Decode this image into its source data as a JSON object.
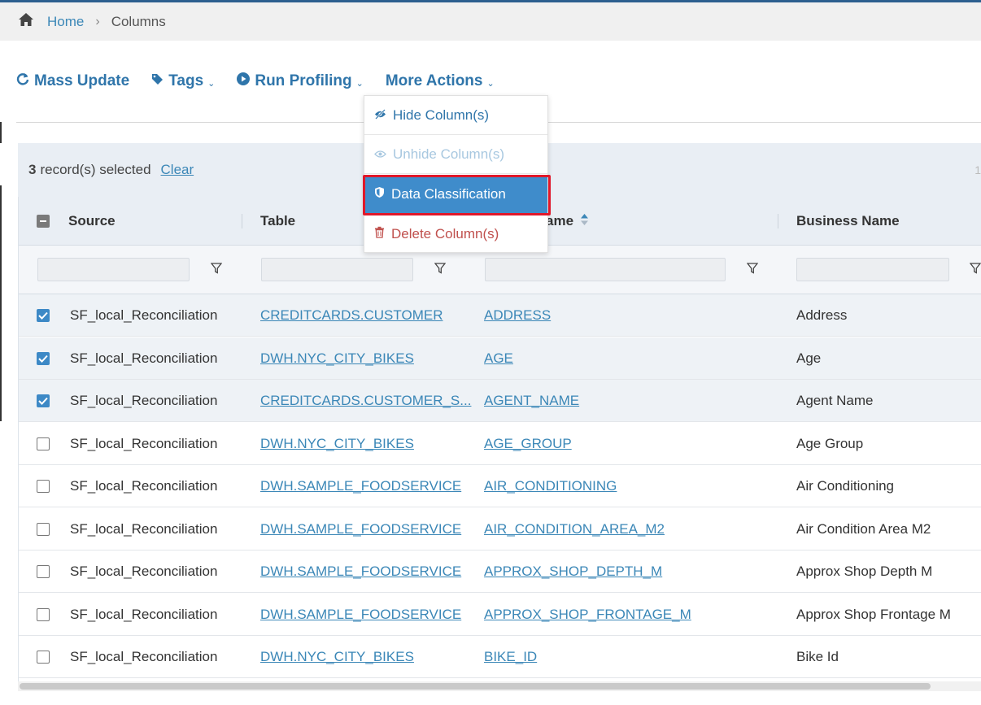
{
  "breadcrumb": {
    "home": "Home",
    "separator": "›",
    "current": "Columns"
  },
  "toolbar": {
    "mass_update": "Mass Update",
    "tags": "Tags",
    "run_profiling": "Run Profiling",
    "more_actions": "More Actions",
    "caret": "⌄"
  },
  "selection": {
    "count": "3",
    "text": "record(s) selected",
    "clear": "Clear",
    "page_info": "1"
  },
  "columns": {
    "source": "Source",
    "table": "Table",
    "name": "ame",
    "business_name": "Business Name"
  },
  "menu": {
    "hide": "Hide Column(s)",
    "unhide": "Unhide Column(s)",
    "classify": "Data Classification",
    "delete": "Delete Column(s)"
  },
  "rows": [
    {
      "checked": true,
      "source": "SF_local_Reconciliation",
      "table": "CREDITCARDS.CUSTOMER",
      "column": "ADDRESS",
      "business": "Address"
    },
    {
      "checked": true,
      "source": "SF_local_Reconciliation",
      "table": "DWH.NYC_CITY_BIKES",
      "column": "AGE",
      "business": "Age"
    },
    {
      "checked": true,
      "source": "SF_local_Reconciliation",
      "table": "CREDITCARDS.CUSTOMER_S...",
      "column": "AGENT_NAME",
      "business": "Agent Name"
    },
    {
      "checked": false,
      "source": "SF_local_Reconciliation",
      "table": "DWH.NYC_CITY_BIKES",
      "column": "AGE_GROUP",
      "business": "Age Group"
    },
    {
      "checked": false,
      "source": "SF_local_Reconciliation",
      "table": "DWH.SAMPLE_FOODSERVICE",
      "column": "AIR_CONDITIONING",
      "business": "Air Conditioning"
    },
    {
      "checked": false,
      "source": "SF_local_Reconciliation",
      "table": "DWH.SAMPLE_FOODSERVICE",
      "column": "AIR_CONDITION_AREA_M2",
      "business": "Air Condition Area M2"
    },
    {
      "checked": false,
      "source": "SF_local_Reconciliation",
      "table": "DWH.SAMPLE_FOODSERVICE",
      "column": "APPROX_SHOP_DEPTH_M",
      "business": "Approx Shop Depth M"
    },
    {
      "checked": false,
      "source": "SF_local_Reconciliation",
      "table": "DWH.SAMPLE_FOODSERVICE",
      "column": "APPROX_SHOP_FRONTAGE_M",
      "business": "Approx Shop Frontage M"
    },
    {
      "checked": false,
      "source": "SF_local_Reconciliation",
      "table": "DWH.NYC_CITY_BIKES",
      "column": "BIKE_ID",
      "business": "Bike Id"
    }
  ],
  "colors": {
    "accent": "#2f75aa",
    "link": "#3b87b7",
    "highlight": "#e0182a",
    "menu_active": "#3f8ccb",
    "danger": "#c0504d"
  }
}
